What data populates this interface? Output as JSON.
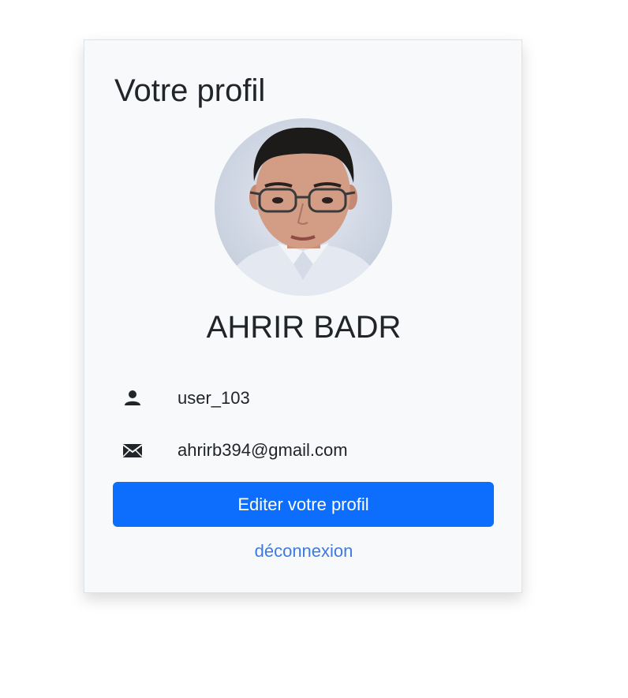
{
  "profile_card": {
    "title": "Votre profil",
    "full_name": "AHRIR BADR",
    "username": "user_103",
    "email": "ahrirb394@gmail.com",
    "edit_button_label": "Editer votre profil",
    "logout_label": "déconnexion",
    "icons": {
      "user": "user-icon",
      "email": "envelope-icon"
    },
    "colors": {
      "card_background": "#f8f9fa",
      "primary_button": "#0d6efd",
      "link": "#3d7be0",
      "text": "#212529"
    }
  }
}
